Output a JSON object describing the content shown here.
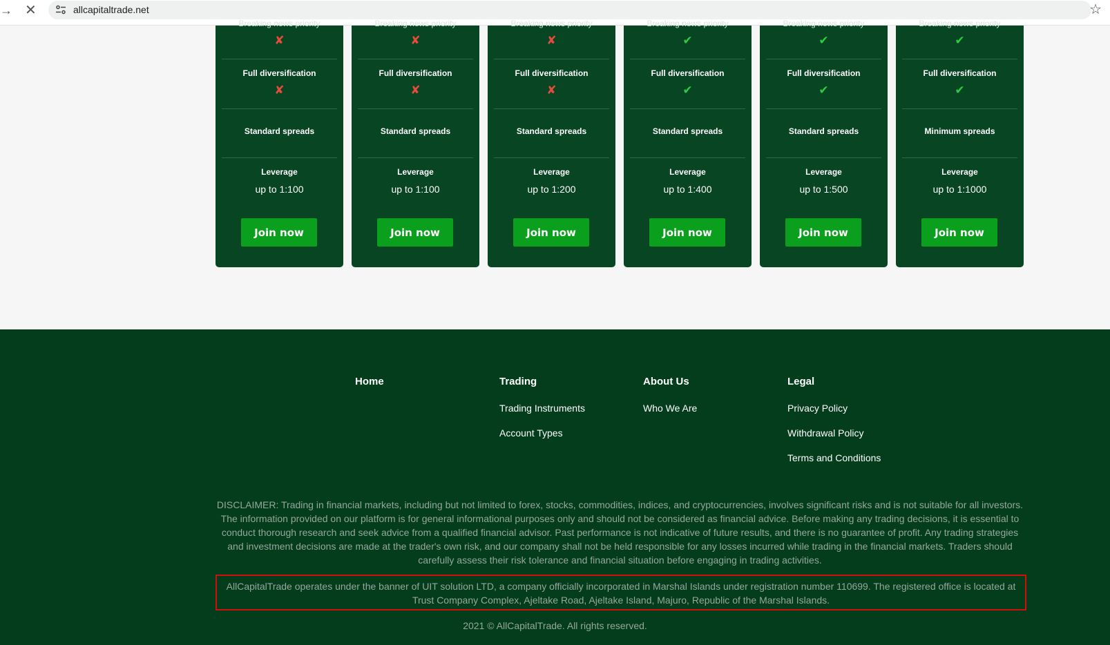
{
  "browser": {
    "url": "allcapitaltrade.net",
    "icons": [
      "arrow-right-icon",
      "close-icon",
      "site-info-icon",
      "star-icon"
    ]
  },
  "cards": [
    {
      "top_label": "Breaking news priority",
      "news": "no",
      "div_label": "Full diversification",
      "div": "no",
      "spreads": "Standard spreads",
      "leverage_label": "Leverage",
      "leverage": "up to 1:100",
      "button": "Join now"
    },
    {
      "top_label": "Breaking news priority",
      "news": "no",
      "div_label": "Full diversification",
      "div": "no",
      "spreads": "Standard spreads",
      "leverage_label": "Leverage",
      "leverage": "up to 1:100",
      "button": "Join now"
    },
    {
      "top_label": "Breaking news priority",
      "news": "no",
      "div_label": "Full diversification",
      "div": "no",
      "spreads": "Standard spreads",
      "leverage_label": "Leverage",
      "leverage": "up to 1:200",
      "button": "Join now"
    },
    {
      "top_label": "Breaking news priority",
      "news": "yes",
      "div_label": "Full diversification",
      "div": "yes",
      "spreads": "Standard spreads",
      "leverage_label": "Leverage",
      "leverage": "up to 1:400",
      "button": "Join now"
    },
    {
      "top_label": "Breaking news priority",
      "news": "yes",
      "div_label": "Full diversification",
      "div": "yes",
      "spreads": "Standard spreads",
      "leverage_label": "Leverage",
      "leverage": "up to 1:500",
      "button": "Join now"
    },
    {
      "top_label": "Breaking news priority",
      "news": "yes",
      "div_label": "Full diversification",
      "div": "yes",
      "spreads": "Minimum spreads",
      "leverage_label": "Leverage",
      "leverage": "up to 1:1000",
      "button": "Join now"
    }
  ],
  "marks": {
    "no": "✘",
    "yes": "✔"
  },
  "colors": {
    "card_bg": "#084523",
    "button_bg": "#0a9f1c",
    "footer_bg": "#033d1c",
    "no": "#e74c3c",
    "yes": "#2ecc40",
    "highlight_border": "#d10f0f"
  },
  "footer": {
    "columns": [
      {
        "head": "Home",
        "links": []
      },
      {
        "head": "Trading",
        "links": [
          "Trading Instruments",
          "Account Types"
        ]
      },
      {
        "head": "About Us",
        "links": [
          "Who We Are"
        ]
      },
      {
        "head": "Legal",
        "links": [
          "Privacy Policy",
          "Withdrawal Policy",
          "Terms and Conditions"
        ]
      }
    ],
    "disclaimer": "DISCLAIMER: Trading in financial markets, including but not limited to forex, stocks, commodities, indices, and cryptocurrencies, involves significant risks and is not suitable for all investors. The information provided on our platform is for general informational purposes only and should not be considered as financial advice. Before making any trading decisions, it is essential to conduct thorough research and seek advice from a qualified financial advisor. Past performance is not indicative of future results, and there is no guarantee of profit. Any trading strategies and investment decisions are made at the trader's own risk, and our company shall not be held responsible for any losses incurred while trading in the financial markets. Traders should carefully assess their risk tolerance and financial situation before engaging in trading activities.",
    "company": "AllCapitalTrade operates under the banner of UIT solution LTD, a company officially incorporated in Marshal Islands under registration number 110699. The registered office is located at Trust Company Complex, Ajeltake Road, Ajeltake Island, Majuro, Republic of the Marshal Islands.",
    "copyright": "2021 © AllCapitalTrade. All rights reserved."
  }
}
